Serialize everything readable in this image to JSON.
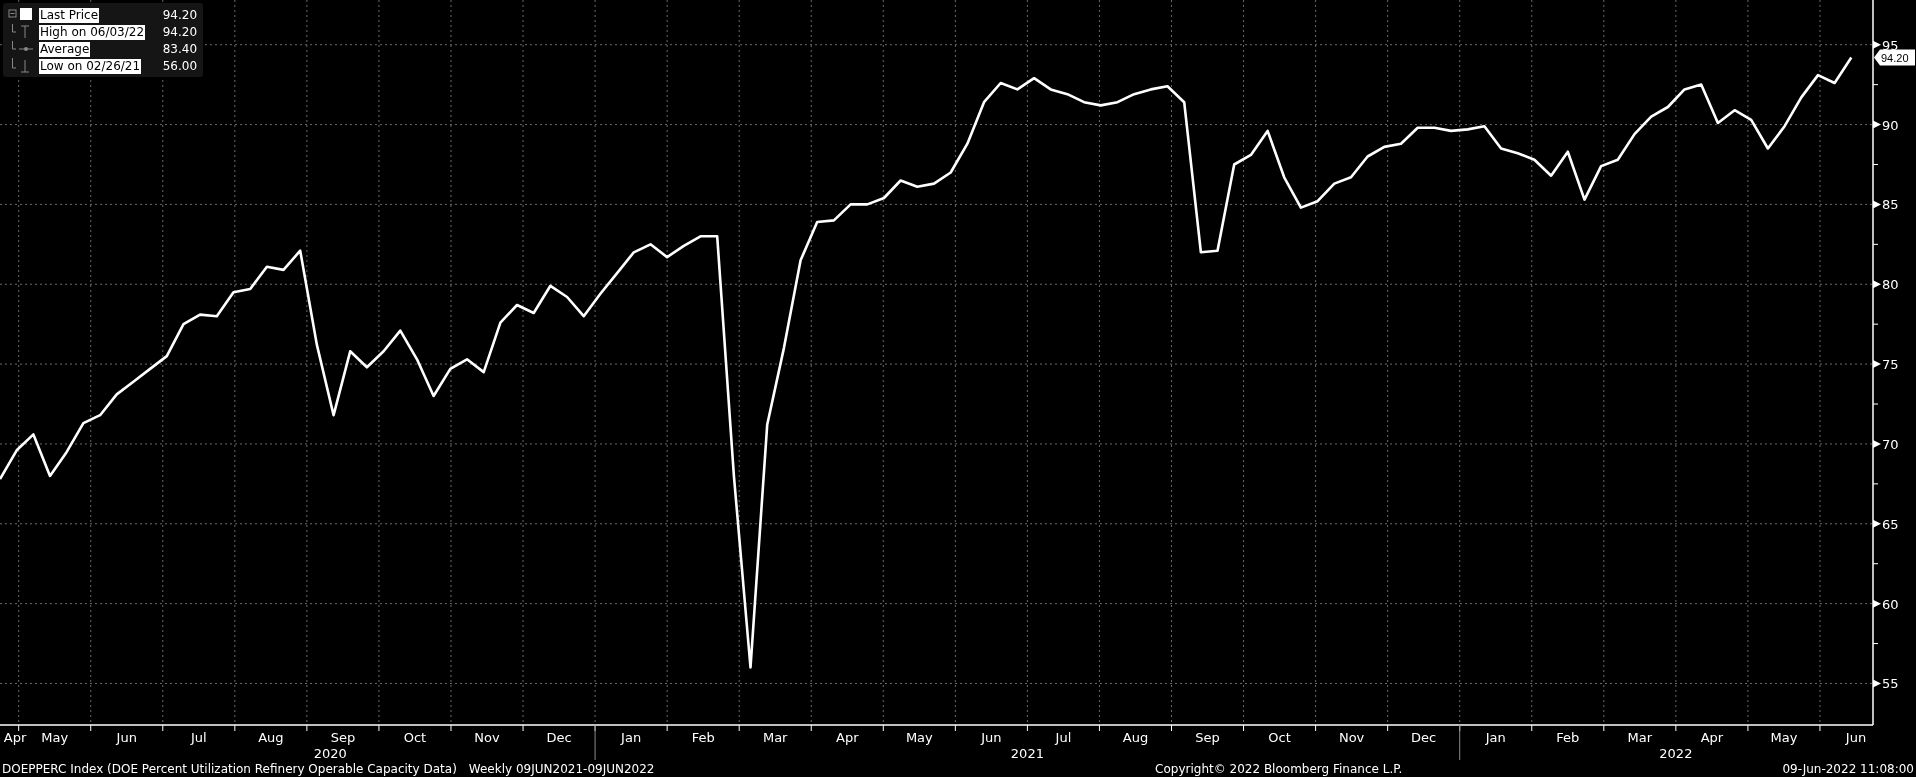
{
  "legend": {
    "items": [
      {
        "kind": "last",
        "label": "Last Price",
        "value": "94.20"
      },
      {
        "kind": "high",
        "label": "High on 06/03/22",
        "value": "94.20"
      },
      {
        "kind": "average",
        "label": "Average",
        "value": "83.40"
      },
      {
        "kind": "low",
        "label": "Low on 02/26/21",
        "value": "56.00"
      }
    ]
  },
  "chart": {
    "chart_data": {
      "type": "line",
      "grid": true,
      "ylim": [
        52.4,
        97.8
      ],
      "yticks": [
        55,
        60,
        65,
        70,
        75,
        80,
        85,
        90,
        95
      ],
      "series": [
        {
          "color": "#ffffff",
          "values": [
            67.8,
            69.6,
            70.6,
            68.0,
            69.5,
            71.3,
            71.8,
            73.1,
            73.9,
            74.7,
            75.5,
            77.5,
            78.1,
            78.0,
            79.5,
            79.7,
            81.1,
            80.9,
            82.1,
            76.2,
            71.8,
            75.8,
            74.8,
            75.8,
            77.1,
            75.3,
            73.0,
            74.7,
            75.3,
            74.5,
            77.6,
            78.7,
            78.2,
            79.9,
            79.2,
            78.0,
            79.4,
            80.7,
            82.0,
            82.5,
            81.7,
            82.4,
            83.0,
            83.0,
            68.0,
            56.0,
            71.2,
            76.0,
            81.5,
            83.9,
            84.0,
            85.0,
            85.0,
            85.4,
            86.5,
            86.1,
            86.3,
            87.0,
            88.8,
            91.4,
            92.6,
            92.2,
            92.9,
            92.2,
            91.9,
            91.4,
            91.2,
            91.4,
            91.9,
            92.2,
            92.4,
            91.4,
            82.0,
            82.1,
            87.5,
            88.1,
            89.6,
            86.7,
            84.8,
            85.2,
            86.3,
            86.7,
            88.0,
            88.6,
            88.8,
            89.8,
            89.8,
            89.6,
            89.7,
            89.9,
            88.5,
            88.2,
            87.8,
            86.8,
            88.3,
            85.3,
            87.4,
            87.8,
            89.4,
            90.5,
            91.1,
            92.2,
            92.5,
            90.1,
            90.9,
            90.3,
            88.5,
            89.9,
            91.7,
            93.1,
            92.6,
            94.2
          ]
        }
      ]
    },
    "years": [
      {
        "label": "2020",
        "months": [
          "Apr",
          "May",
          "Jun",
          "Jul",
          "Aug",
          "Sep",
          "Oct",
          "Nov",
          "Dec"
        ]
      },
      {
        "label": "2021",
        "months": [
          "Jan",
          "Feb",
          "Mar",
          "Apr",
          "May",
          "Jun",
          "Jul",
          "Aug",
          "Sep",
          "Oct",
          "Nov",
          "Dec"
        ]
      },
      {
        "label": "2022",
        "months": [
          "Jan",
          "Feb",
          "Mar",
          "Apr",
          "May",
          "Jun"
        ]
      }
    ],
    "last_value_tag": "94.20"
  },
  "footer": {
    "title": "DOEPPERC Index (DOE Percent Utilization Refinery Operable Capacity Data)",
    "period": "Weekly 09JUN2021-09JUN2022",
    "copyright": "Copyright© 2022 Bloomberg Finance L.P.",
    "timestamp": "09-Jun-2022 11:08:00"
  }
}
